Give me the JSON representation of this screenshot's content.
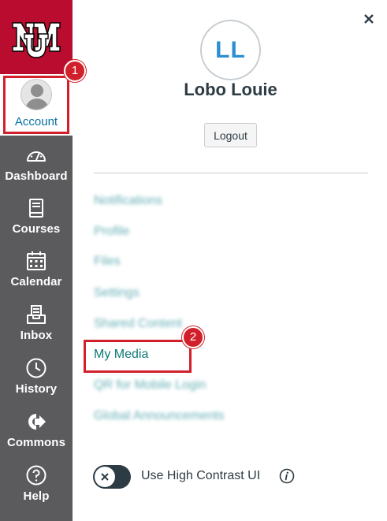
{
  "nav": {
    "logo": {
      "text": "UNM",
      "icon": "unm-logo-icon",
      "background": "#ba0c2f"
    },
    "account": {
      "label": "Account",
      "icon": "avatar-icon",
      "active": true
    },
    "items": [
      {
        "key": "dashboard",
        "label": "Dashboard",
        "icon": "speedometer-icon"
      },
      {
        "key": "courses",
        "label": "Courses",
        "icon": "book-icon"
      },
      {
        "key": "calendar",
        "label": "Calendar",
        "icon": "calendar-icon"
      },
      {
        "key": "inbox",
        "label": "Inbox",
        "icon": "inbox-icon"
      },
      {
        "key": "history",
        "label": "History",
        "icon": "clock-icon"
      },
      {
        "key": "commons",
        "label": "Commons",
        "icon": "commons-arrow-icon"
      },
      {
        "key": "help",
        "label": "Help",
        "icon": "question-circle-icon"
      }
    ],
    "background": "#5b5b5e"
  },
  "tray": {
    "close_icon": "close-icon",
    "avatar_initials": "LL",
    "user_name": "Lobo Louie",
    "logout_label": "Logout",
    "links": [
      {
        "label": "Notifications",
        "blurred": true
      },
      {
        "label": "Profile",
        "blurred": true
      },
      {
        "label": "Files",
        "blurred": true
      },
      {
        "label": "Settings",
        "blurred": true
      },
      {
        "label": "Shared Content",
        "blurred": true
      },
      {
        "label": "My Media",
        "blurred": false
      },
      {
        "label": "QR for Mobile Login",
        "blurred": true
      },
      {
        "label": "Global Announcements",
        "blurred": true
      }
    ],
    "high_contrast": {
      "label": "Use High Contrast UI",
      "enabled": false
    }
  },
  "callouts": [
    {
      "number": "1",
      "target": "Account"
    },
    {
      "number": "2",
      "target": "My Media"
    }
  ],
  "colors": {
    "highlight": "#d1202b",
    "link": "#0b7a75",
    "initials": "#2d8fd0",
    "text": "#2d3b45"
  }
}
